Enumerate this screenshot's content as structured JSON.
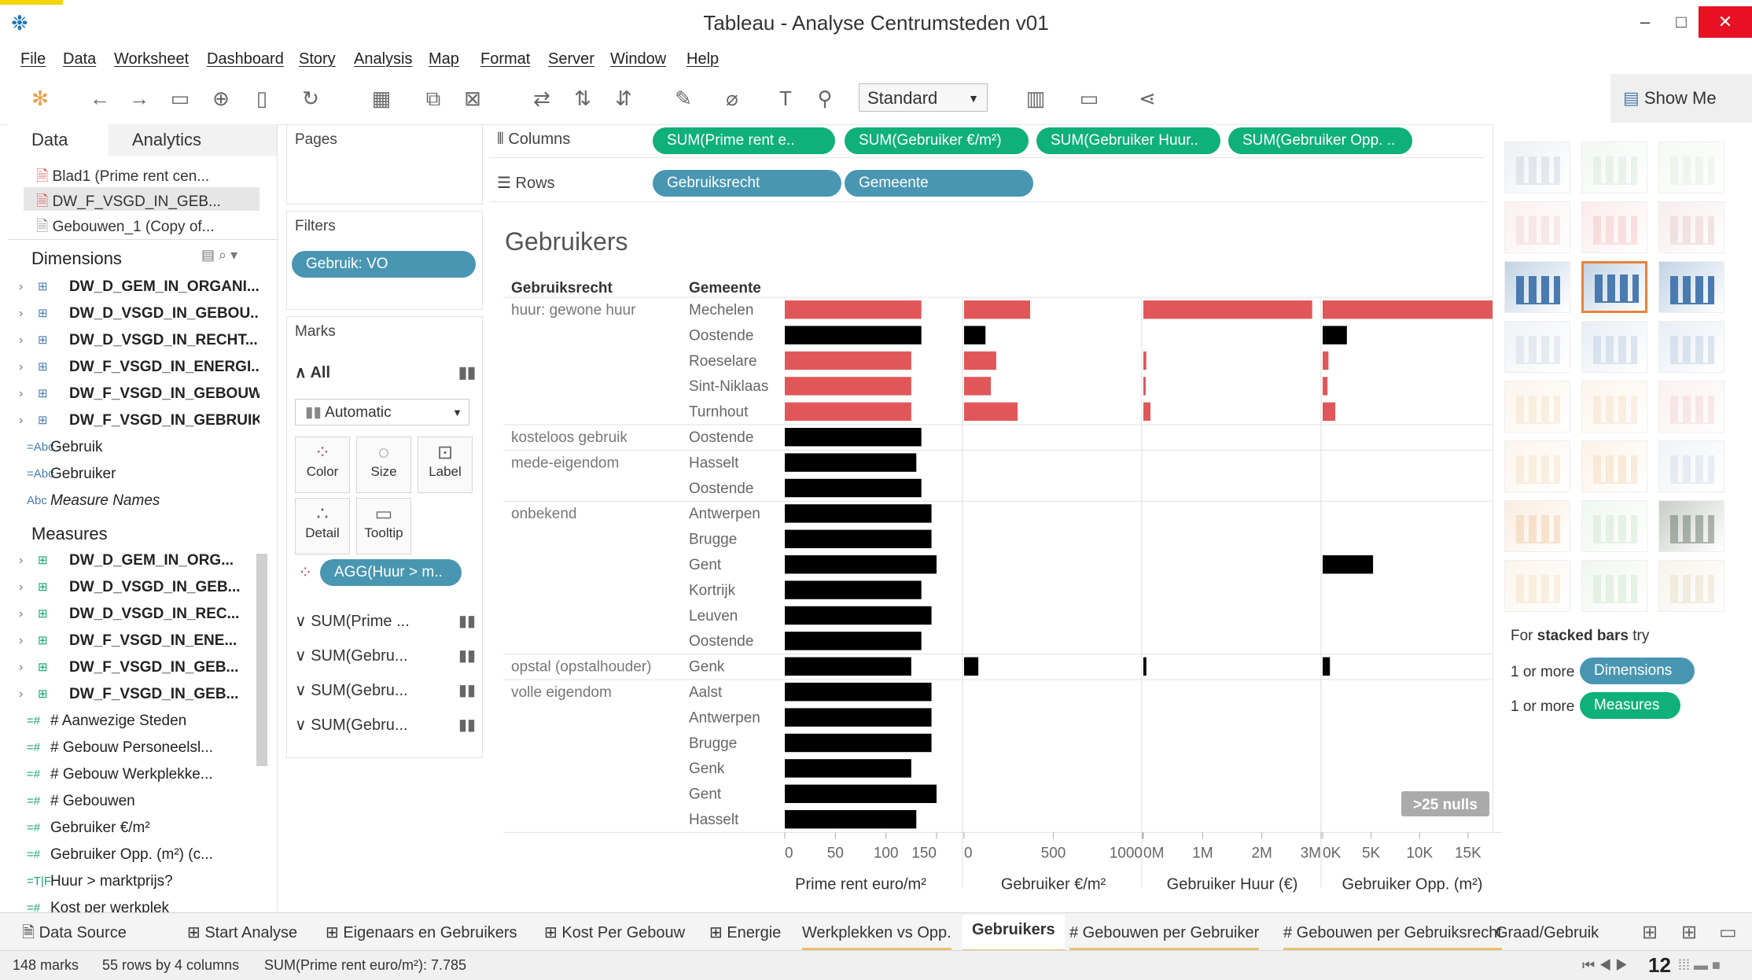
{
  "window": {
    "title": "Tableau - Analyse Centrumsteden v01",
    "minimize": "–",
    "maximize": "□",
    "close": "✕"
  },
  "menu": [
    "File",
    "Data",
    "Worksheet",
    "Dashboard",
    "Story",
    "Analysis",
    "Map",
    "Format",
    "Server",
    "Window",
    "Help"
  ],
  "toolbar": {
    "fit": "Standard",
    "show_me": "Show Me"
  },
  "data_pane": {
    "tab_data": "Data",
    "tab_analytics": "Analytics",
    "datasources": [
      "Blad1 (Prime rent cen...",
      "DW_F_VSGD_IN_GEB...",
      "Gebouwen_1 (Copy of..."
    ],
    "dimensions_header": "Dimensions",
    "dimensions": [
      {
        "icon": "⊞",
        "label": "DW_D_GEM_IN_ORGANI...",
        "bold": true
      },
      {
        "icon": "⊞",
        "label": "DW_D_VSGD_IN_GEBOU...",
        "bold": true
      },
      {
        "icon": "⊞",
        "label": "DW_D_VSGD_IN_RECHT...",
        "bold": true
      },
      {
        "icon": "⊞",
        "label": "DW_F_VSGD_IN_ENERGI...",
        "bold": true
      },
      {
        "icon": "⊞",
        "label": "DW_F_VSGD_IN_GEBOUW",
        "bold": true
      },
      {
        "icon": "⊞",
        "label": "DW_F_VSGD_IN_GEBRUIK",
        "bold": true
      },
      {
        "icon": "=Abc",
        "label": "Gebruik",
        "bold": false
      },
      {
        "icon": "=Abc",
        "label": "Gebruiker",
        "bold": false
      },
      {
        "icon": "Abc",
        "label": "Measure Names",
        "bold": false
      }
    ],
    "measures_header": "Measures",
    "measures": [
      {
        "icon": "⊞",
        "label": "DW_D_GEM_IN_ORG...",
        "bold": true
      },
      {
        "icon": "⊞",
        "label": "DW_D_VSGD_IN_GEB...",
        "bold": true
      },
      {
        "icon": "⊞",
        "label": "DW_D_VSGD_IN_REC...",
        "bold": true
      },
      {
        "icon": "⊞",
        "label": "DW_F_VSGD_IN_ENE...",
        "bold": true
      },
      {
        "icon": "⊞",
        "label": "DW_F_VSGD_IN_GEB...",
        "bold": true
      },
      {
        "icon": "⊞",
        "label": "DW_F_VSGD_IN_GEB...",
        "bold": true
      },
      {
        "icon": "=#",
        "label": "# Aanwezige Steden",
        "bold": false
      },
      {
        "icon": "=#",
        "label": "# Gebouw Personeelsl...",
        "bold": false
      },
      {
        "icon": "=#",
        "label": "# Gebouw Werkplekke...",
        "bold": false
      },
      {
        "icon": "=#",
        "label": "# Gebouwen",
        "bold": false
      },
      {
        "icon": "=#",
        "label": "Gebruiker €/m²",
        "bold": false
      },
      {
        "icon": "=#",
        "label": "Gebruiker Opp. (m²) (c...",
        "bold": false
      },
      {
        "icon": "=T|F",
        "label": "Huur > marktprijs?",
        "bold": false
      },
      {
        "icon": "=#",
        "label": "Kost per werkplek",
        "bold": false
      }
    ]
  },
  "shelves": {
    "pages": "Pages",
    "filters": "Filters",
    "filter_pill": "Gebruik: VO",
    "columns": "Columns",
    "rows": "Rows",
    "column_pills": [
      "SUM(Prime rent e..",
      "SUM(Gebruiker €/m²)",
      "SUM(Gebruiker Huur..",
      "SUM(Gebruiker Opp. .."
    ],
    "row_pills": [
      "Gebruiksrecht",
      "Gemeente"
    ]
  },
  "marks": {
    "title": "Marks",
    "all": "All",
    "mark_type": "Automatic",
    "buttons": [
      "Color",
      "Size",
      "Label",
      "Detail",
      "Tooltip"
    ],
    "color_pill": "AGG(Huur > m..",
    "sub_cards": [
      "SUM(Prime ...",
      "SUM(Gebru...",
      "SUM(Gebru...",
      "SUM(Gebru..."
    ]
  },
  "chart_data": {
    "type": "bar",
    "title": "Gebruikers",
    "row_headers": [
      "Gebruiksrecht",
      "Gemeente"
    ],
    "groups": [
      {
        "name": "huur: gewone huur",
        "rows": [
          "Mechelen",
          "Oostende",
          "Roeselare",
          "Sint-Niklaas",
          "Turnhout"
        ]
      },
      {
        "name": "kosteloos gebruik",
        "rows": [
          "Oostende"
        ]
      },
      {
        "name": "mede-eigendom",
        "rows": [
          "Hasselt",
          "Oostende"
        ]
      },
      {
        "name": "onbekend",
        "rows": [
          "Antwerpen",
          "Brugge",
          "Gent",
          "Kortrijk",
          "Leuven",
          "Oostende"
        ]
      },
      {
        "name": "opstal (opstalhouder)",
        "rows": [
          "Genk"
        ]
      },
      {
        "name": "volle eigendom",
        "rows": [
          "Aalst",
          "Antwerpen",
          "Brugge",
          "Genk",
          "Gent",
          "Hasselt"
        ]
      }
    ],
    "colors": {
      "true": "#e15759",
      "false": "#000000"
    },
    "row_color": [
      "true",
      "false",
      "true",
      "true",
      "true",
      "false",
      "false",
      "false",
      "false",
      "false",
      "false",
      "false",
      "false",
      "false",
      "false",
      "false",
      "false",
      "false",
      "false",
      "false",
      "false"
    ],
    "series": [
      {
        "name": "Prime rent euro/m²",
        "max": 150,
        "ticks": [
          "0",
          "50",
          "100",
          "150"
        ],
        "values": [
          135,
          135,
          125,
          125,
          125,
          135,
          130,
          135,
          145,
          145,
          150,
          135,
          145,
          135,
          125,
          145,
          145,
          145,
          125,
          150,
          130
        ]
      },
      {
        "name": "Gebruiker €/m²",
        "max": 1000,
        "ticks": [
          "0",
          "500",
          "1000"
        ],
        "values": [
          370,
          120,
          180,
          150,
          300,
          null,
          null,
          null,
          null,
          null,
          null,
          null,
          null,
          null,
          80,
          null,
          null,
          null,
          null,
          null,
          null
        ]
      },
      {
        "name": "Gebruiker Huur (€)",
        "max": 3000000,
        "ticks": [
          "0M",
          "1M",
          "2M",
          "3M"
        ],
        "values": [
          2850000,
          null,
          50000,
          40000,
          120000,
          null,
          null,
          null,
          null,
          null,
          null,
          null,
          null,
          null,
          50000,
          null,
          null,
          null,
          null,
          null,
          null
        ]
      },
      {
        "name": "Gebruiker Opp. (m²)",
        "max": 18500,
        "ticks": [
          "0K",
          "5K",
          "10K",
          "15K"
        ],
        "values": [
          19000,
          2500,
          600,
          500,
          1300,
          null,
          null,
          null,
          null,
          null,
          5200,
          null,
          null,
          null,
          750,
          null,
          null,
          null,
          null,
          null,
          null
        ]
      }
    ],
    "nulls_badge": ">25 nulls"
  },
  "show_me": {
    "hint_pre": "For",
    "hint_bold": "stacked bars",
    "hint_post": "try",
    "req1_pre": "1 or more",
    "req1_pill": "Dimensions",
    "req2_pre": "1 or more",
    "req2_pill": "Measures"
  },
  "sheet_tabs": [
    "Data Source",
    "Start Analyse",
    "Eigenaars en Gebruikers",
    "Kost Per Gebouw",
    "Energie",
    "Werkplekken vs Opp.",
    "Gebruikers",
    "# Gebouwen per Gebruiker",
    "# Gebouwen per Gebruiksrecht",
    "Graad/Gebruik"
  ],
  "active_tab": "Gebruikers",
  "status": {
    "marks": "148 marks",
    "dims": "55 rows by 4 columns",
    "sum": "SUM(Prime rent euro/m²): 7.785",
    "page": "12"
  }
}
